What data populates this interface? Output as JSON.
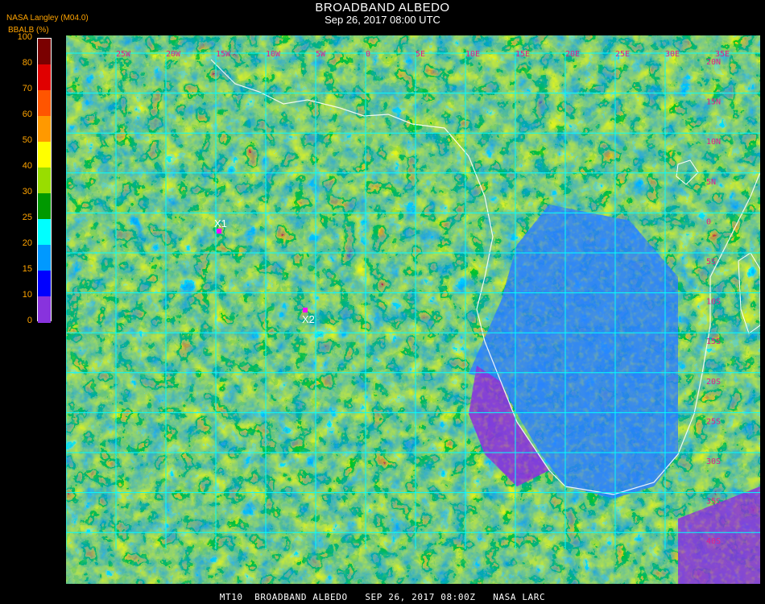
{
  "title": "BROADBAND ALBEDO",
  "subtitle": "Sep 26, 2017 08:00 UTC",
  "source_label": "NASA Langley (M04.0)",
  "product_label": "BBALB (%)",
  "colorbar": {
    "ticks": [
      "100",
      "80",
      "70",
      "60",
      "50",
      "40",
      "30",
      "25",
      "20",
      "15",
      "10",
      "0"
    ],
    "colors": [
      "#7a0000",
      "#e00000",
      "#ff5500",
      "#ff9900",
      "#ffff00",
      "#99dd00",
      "#009900",
      "#00ffff",
      "#0099ff",
      "#0000ff",
      "#8833dd"
    ]
  },
  "map": {
    "lon_labels": [
      "25W",
      "20W",
      "15W",
      "10W",
      "5W",
      "0",
      "5E",
      "10E",
      "15E",
      "20E",
      "25E",
      "30E",
      "35E"
    ],
    "lat_labels": [
      "20N",
      "15N",
      "10N",
      "5N",
      "0",
      "5S",
      "10S",
      "15S",
      "20S",
      "25S",
      "30S",
      "35S",
      "40S"
    ],
    "grid_color": "#00ffff",
    "markers": [
      {
        "label": "X1",
        "color": "#ff00ff"
      },
      {
        "label": "X2",
        "color": "#ff00ff"
      }
    ]
  },
  "footer": "MT10  BROADBAND ALBEDO   SEP 26, 2017 08:00Z   NASA LARC"
}
